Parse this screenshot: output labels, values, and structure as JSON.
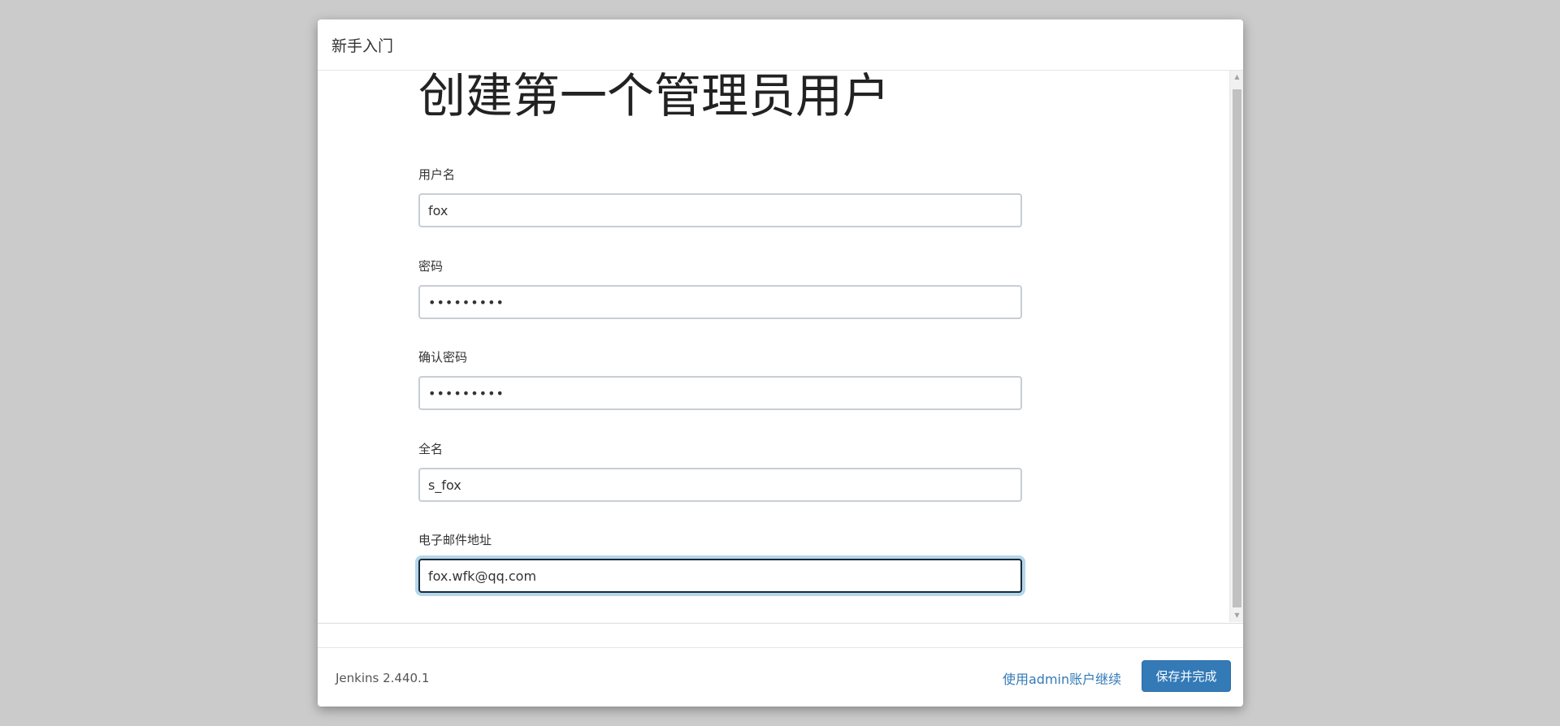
{
  "dialog": {
    "title": "新手入门"
  },
  "form": {
    "heading": "创建第一个管理员用户",
    "fields": [
      {
        "label": "用户名",
        "value": "fox"
      },
      {
        "label": "密码",
        "value": "•••••••••"
      },
      {
        "label": "确认密码",
        "value": "•••••••••"
      },
      {
        "label": "全名",
        "value": "s_fox"
      },
      {
        "label": "电子邮件地址",
        "value": "fox.wfk@qq.com"
      }
    ]
  },
  "footer": {
    "version": "Jenkins 2.440.1",
    "continue_as_admin": "使用admin账户继续",
    "save_label": "保存并完成"
  },
  "icons": {
    "scroll_up": "triangle-up-icon",
    "scroll_down": "triangle-down-icon"
  },
  "colors": {
    "primary": "#337ab7",
    "focus_ring": "#b4d6ea",
    "backdrop": "#cbcbcb"
  }
}
